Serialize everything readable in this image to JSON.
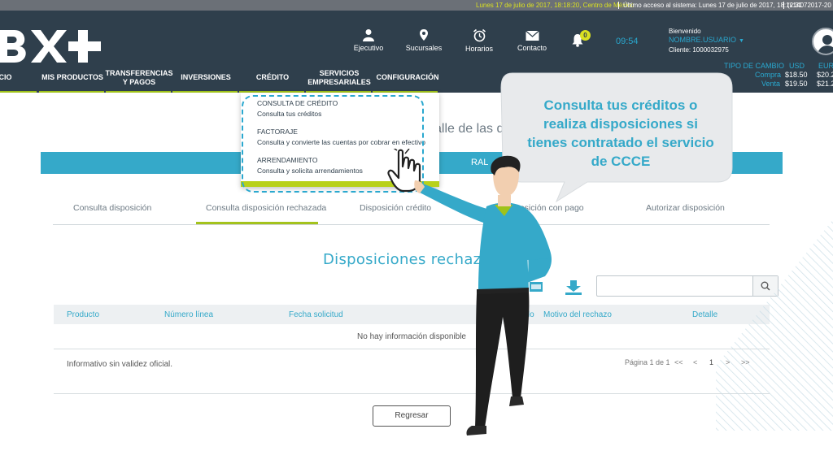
{
  "status_bar": {
    "date_text": "Lunes 17 de julio de 2017, 18:18:20, Centro de México",
    "last_access": "Último acceso al sistema: Lunes 17 de julio de 2017, 18:12:31",
    "version": "(v14072017-20"
  },
  "header": {
    "logo_text": "BX+",
    "icons": [
      {
        "label": "Ejecutivo",
        "icon": "person-icon"
      },
      {
        "label": "Sucursales",
        "icon": "location-pin-icon"
      },
      {
        "label": "Horarios",
        "icon": "alarm-clock-icon"
      },
      {
        "label": "Contacto",
        "icon": "envelope-icon"
      }
    ],
    "notifications_count": "0",
    "clock": "09:54",
    "welcome_label": "Bienvenido",
    "user_name": "NOMBRE.USUARIO",
    "client_label": "Cliente: 1000032975"
  },
  "nav": {
    "items": [
      "ICIO",
      "MIS PRODUCTOS",
      "TRANSFERENCIAS\nY PAGOS",
      "INVERSIONES",
      "CRÉDITO",
      "SERVICIOS\nEMPRESARIALES",
      "CONFIGURACIÓN"
    ]
  },
  "exchange": {
    "title": "TIPO DE CAMBIO",
    "usd": "USD",
    "eur": "EUR",
    "buy_label": "Compra",
    "sell_label": "Venta",
    "usd_buy": "$18.50",
    "usd_sell": "$19.50",
    "eur_buy": "$20.2",
    "eur_sell": "$21.2"
  },
  "dropdown": {
    "items": [
      {
        "title": "CONSULTA DE CRÉDITO",
        "subtitle": "Consulta tus créditos"
      },
      {
        "title": "FACTORAJE",
        "subtitle": "Consulta y convierte las cuentas por cobrar en efectivo"
      },
      {
        "title": "ARRENDAMIENTO",
        "subtitle": "Consulta y solicita arrendamientos"
      }
    ]
  },
  "page": {
    "title_fragment": "alle de las dispo",
    "banner_fragment": "RAL",
    "tabs": [
      "Consulta disposición",
      "Consulta disposición rechazada",
      "Disposición crédito",
      "posición con pago",
      "Autorizar disposición"
    ],
    "active_tab_index": 1,
    "section_title": "Disposiciones rechaza",
    "search_placeholder": "",
    "table_headers": [
      "Producto",
      "Número línea",
      "Fecha solicitud",
      "itado",
      "Motivo del rechazo",
      "Detalle"
    ],
    "empty_message": "No hay información disponible",
    "footer_note": "Informativo sin validez oficial.",
    "pager_text": "Página 1 de 1",
    "pager_first": "<<",
    "pager_prev": "<",
    "pager_current": "1",
    "pager_next": ">",
    "pager_last": ">>",
    "back_button": "Regresar"
  },
  "callout": {
    "text": "Consulta tus créditos o realiza disposiciones si tienes contratado el servicio de CCCE"
  },
  "colors": {
    "header_bg": "#2f3f4c",
    "accent_blue": "#35a9c9",
    "accent_green": "#a4c31c",
    "yellow": "#d9e021"
  }
}
